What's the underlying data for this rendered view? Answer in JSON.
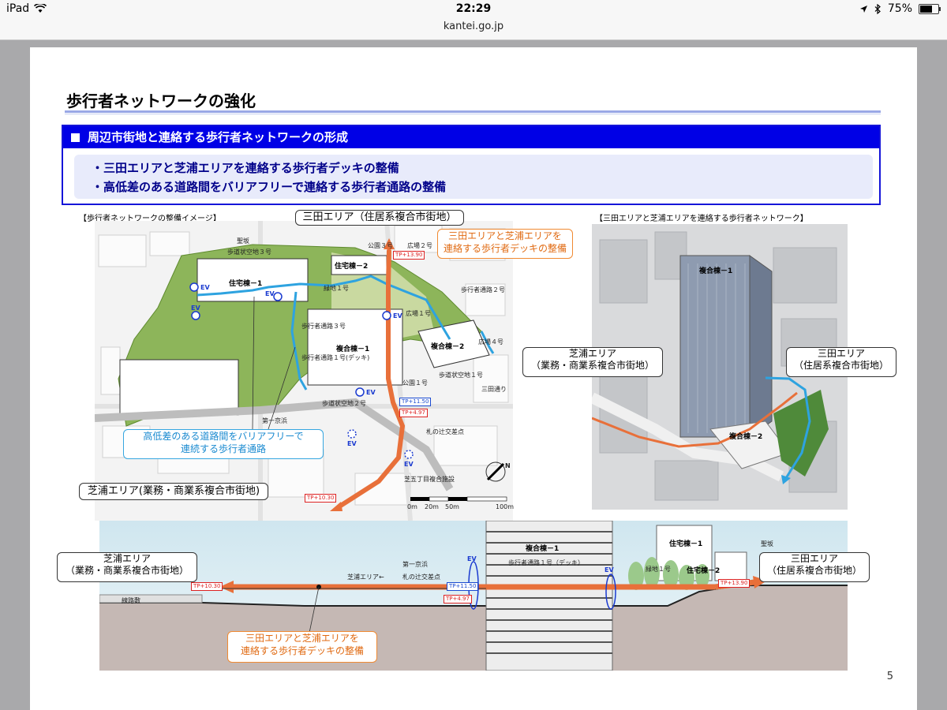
{
  "status_bar": {
    "carrier": "iPad",
    "time": "22:29",
    "battery": "75%",
    "battery_level": 0.75
  },
  "browser": {
    "url": "kantei.go.jp"
  },
  "slide": {
    "title": "歩行者ネットワークの強化",
    "box_heading": "周辺市街地と連絡する歩行者ネットワークの形成",
    "bullets": [
      "・三田エリアと芝浦エリアを連絡する歩行者デッキの整備",
      "・高低差のある道路間をバリアフリーで連絡する歩行者通路の整備"
    ],
    "page_number": "5"
  },
  "map_panel": {
    "caption": "【歩行者ネットワークの整備イメージ】",
    "mita_label": "三田エリア（住居系複合市街地）",
    "shibaura_label": "芝浦エリア(業務・商業系複合市街地)",
    "callout_deck": [
      "三田エリアと芝浦エリアを",
      "連絡する歩行者デッキの整備"
    ],
    "callout_barrier": [
      "高低差のある道路間をバリアフリーで",
      "連続する歩行者通路"
    ],
    "buildings": {
      "residential_1": "住宅棟－1",
      "residential_2": "住宅棟－2",
      "complex_1": "複合棟－1",
      "complex_2": "複合棟－2"
    },
    "labels": {
      "seizaka": "聖坂",
      "hodo3_top": "歩道状空地３号",
      "park3": "公園３号",
      "plaza2": "広場２号",
      "green1": "緑地１号",
      "hokou2": "歩行者通路２号",
      "plaza1": "広場１号",
      "plaza4": "広場４号",
      "hokou3": "歩行者通路３号",
      "hokou1": "歩行者通路１号(デッキ)",
      "park1": "公園１号",
      "hodo1": "歩道状空地１号",
      "mita_dori": "三田通り",
      "hodo2": "歩道状空地２号",
      "daiichi_keihin": "第一京浜",
      "fuda_no_tsuji": "札の辻交差点",
      "shiba5": "芝五丁目複合施設",
      "ev": "EV"
    },
    "tp_values": [
      "TP+13.90",
      "TP+11.50",
      "TP+4.97",
      "TP+10.30"
    ],
    "scale": [
      "0m",
      "20m",
      "50m",
      "100m"
    ],
    "north": "N"
  },
  "photo_panel": {
    "caption": "【三田エリアと芝浦エリアを連絡する歩行者ネットワーク】",
    "shibaura_label": [
      "芝浦エリア",
      "（業務・商業系複合市街地）"
    ],
    "mita_label": [
      "三田エリア",
      "（住居系複合市街地）"
    ],
    "complex_1": "複合棟－1",
    "complex_2": "複合棟－2"
  },
  "section_panel": {
    "shibaura_label": [
      "芝浦エリア",
      "（業務・商業系複合市街地）"
    ],
    "mita_label": [
      "三田エリア",
      "（住居系複合市街地）"
    ],
    "callout_deck": [
      "三田エリアと芝浦エリアを",
      "連絡する歩行者デッキの整備"
    ],
    "complex_1": "複合棟－1",
    "residential_1": "住宅棟－1",
    "residential_2": "住宅棟－2",
    "deck_label": "歩行者通路１号（デッキ）",
    "shibaura_area": "芝浦エリア←",
    "daiichi_keihin": "第一京浜",
    "fuda_no_tsuji": "札の辻交差点",
    "green1": "緑地１号",
    "seizaka": "聖坂",
    "rail": "線路敷",
    "ev": "EV",
    "tp_values": [
      "TP+10.30",
      "TP+11.50",
      "TP+4.97",
      "TP+13.90"
    ]
  }
}
